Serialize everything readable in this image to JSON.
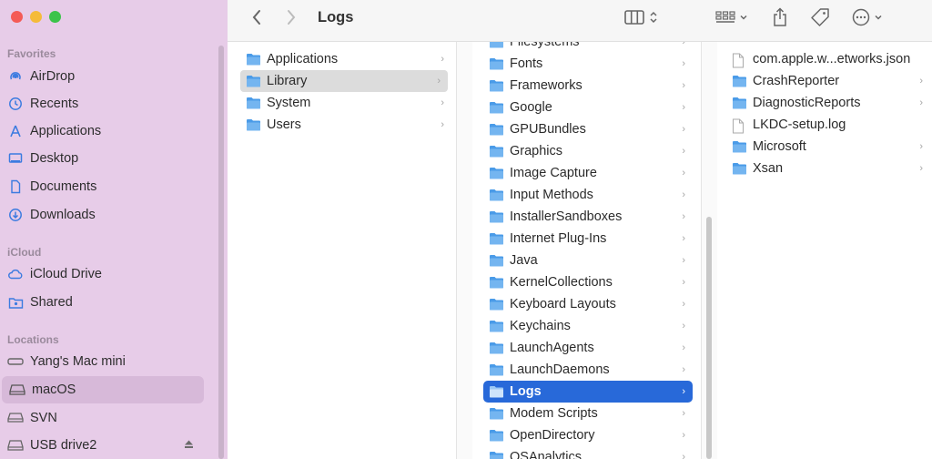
{
  "window": {
    "title": "Logs"
  },
  "sidebar": {
    "sections": [
      {
        "title": "Favorites",
        "items": [
          {
            "label": "AirDrop",
            "icon": "airdrop-icon"
          },
          {
            "label": "Recents",
            "icon": "clock-icon"
          },
          {
            "label": "Applications",
            "icon": "applications-icon"
          },
          {
            "label": "Desktop",
            "icon": "desktop-icon"
          },
          {
            "label": "Documents",
            "icon": "document-icon"
          },
          {
            "label": "Downloads",
            "icon": "download-icon"
          }
        ]
      },
      {
        "title": "iCloud",
        "items": [
          {
            "label": "iCloud Drive",
            "icon": "cloud-icon"
          },
          {
            "label": "Shared",
            "icon": "shared-folder-icon"
          }
        ]
      },
      {
        "title": "Locations",
        "items": [
          {
            "label": "Yang's Mac mini",
            "icon": "computer-icon"
          },
          {
            "label": "macOS",
            "icon": "disk-icon",
            "selected": true
          },
          {
            "label": "SVN",
            "icon": "network-drive-icon"
          },
          {
            "label": "USB drive2",
            "icon": "disk-icon"
          }
        ]
      }
    ]
  },
  "column1": {
    "items": [
      {
        "label": "Applications"
      },
      {
        "label": "Library",
        "selected": true
      },
      {
        "label": "System"
      },
      {
        "label": "Users"
      }
    ]
  },
  "column2": {
    "items": [
      {
        "label": "Filesystems"
      },
      {
        "label": "Fonts"
      },
      {
        "label": "Frameworks"
      },
      {
        "label": "Google"
      },
      {
        "label": "GPUBundles"
      },
      {
        "label": "Graphics"
      },
      {
        "label": "Image Capture"
      },
      {
        "label": "Input Methods"
      },
      {
        "label": "InstallerSandboxes"
      },
      {
        "label": "Internet Plug-Ins"
      },
      {
        "label": "Java"
      },
      {
        "label": "KernelCollections"
      },
      {
        "label": "Keyboard Layouts"
      },
      {
        "label": "Keychains"
      },
      {
        "label": "LaunchAgents"
      },
      {
        "label": "LaunchDaemons"
      },
      {
        "label": "Logs",
        "selected": true
      },
      {
        "label": "Modem Scripts"
      },
      {
        "label": "OpenDirectory"
      },
      {
        "label": "OSAnalytics"
      }
    ]
  },
  "column3": {
    "items": [
      {
        "label": "com.apple.w...etworks.json",
        "kind": "file"
      },
      {
        "label": "CrashReporter",
        "kind": "folder"
      },
      {
        "label": "DiagnosticReports",
        "kind": "folder"
      },
      {
        "label": "LKDC-setup.log",
        "kind": "file"
      },
      {
        "label": "Microsoft",
        "kind": "folder"
      },
      {
        "label": "Xsan",
        "kind": "folder"
      }
    ]
  },
  "colors": {
    "sidebar_bg": "#e7cce8",
    "selection_blue": "#2869d9",
    "folder_blue": "#4a9be8"
  }
}
